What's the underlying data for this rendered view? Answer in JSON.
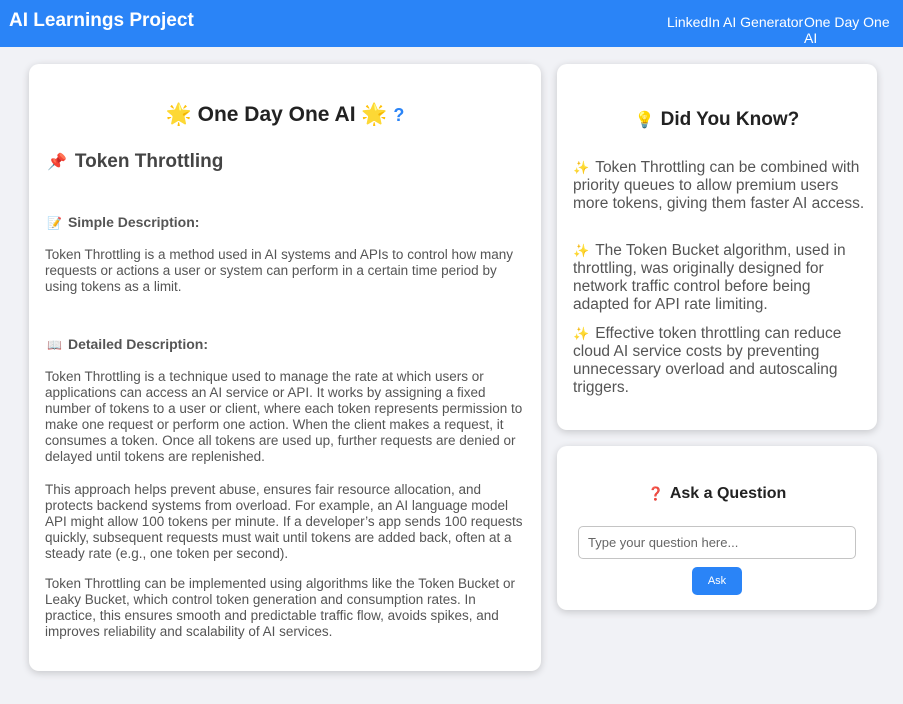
{
  "navbar": {
    "brand": "AI Learnings Project",
    "links": [
      "LinkedIn AI Generator",
      "One Day One AI"
    ]
  },
  "main": {
    "title": "One Day One AI",
    "title_icon": "sun-icon",
    "help_glyph": "?",
    "topic": "Token Throttling",
    "topic_icon": "pushpin-icon",
    "simple_heading": "Simple Description:",
    "simple_icon": "memo-icon",
    "simple_text": "Token Throttling is a method used in AI systems and APIs to control how many requests or actions a user or system can perform in a certain time period by using tokens as a limit.",
    "detailed_heading": "Detailed Description:",
    "detailed_icon": "open-book-icon",
    "detailed_paragraphs": [
      "Token Throttling is a technique used to manage the rate at which users or applications can access an AI service or API. It works by assigning a fixed number of tokens to a user or client, where each token represents permission to make one request or perform one action. When the client makes a request, it consumes a token. Once all tokens are used up, further requests are denied or delayed until tokens are replenished.",
      "This approach helps prevent abuse, ensures fair resource allocation, and protects backend systems from overload. For example, an AI language model API might allow 100 tokens per minute. If a developer’s app sends 100 requests quickly, subsequent requests must wait until tokens are added back, often at a steady rate (e.g., one token per second).",
      "Token Throttling can be implemented using algorithms like the Token Bucket or Leaky Bucket, which control token generation and consumption rates. In practice, this ensures smooth and predictable traffic flow, avoids spikes, and improves reliability and scalability of AI services."
    ]
  },
  "did_you_know": {
    "title": "Did You Know?",
    "title_icon": "light-bulb-icon",
    "fact_icon": "sparkles-icon",
    "facts": [
      "Token Throttling can be combined with priority queues to allow premium users more tokens, giving them faster AI access.",
      "The Token Bucket algorithm, used in throttling, was originally designed for network traffic control before being adapted for API rate limiting.",
      "Effective token throttling can reduce cloud AI service costs by preventing unnecessary overload and autoscaling triggers."
    ]
  },
  "ask": {
    "title": "Ask a Question",
    "title_icon": "question-mark-icon",
    "placeholder": "Type your question here...",
    "value": "",
    "button_label": "Ask"
  },
  "colors": {
    "accent": "#2a84f7",
    "background": "#f1f2f6"
  }
}
